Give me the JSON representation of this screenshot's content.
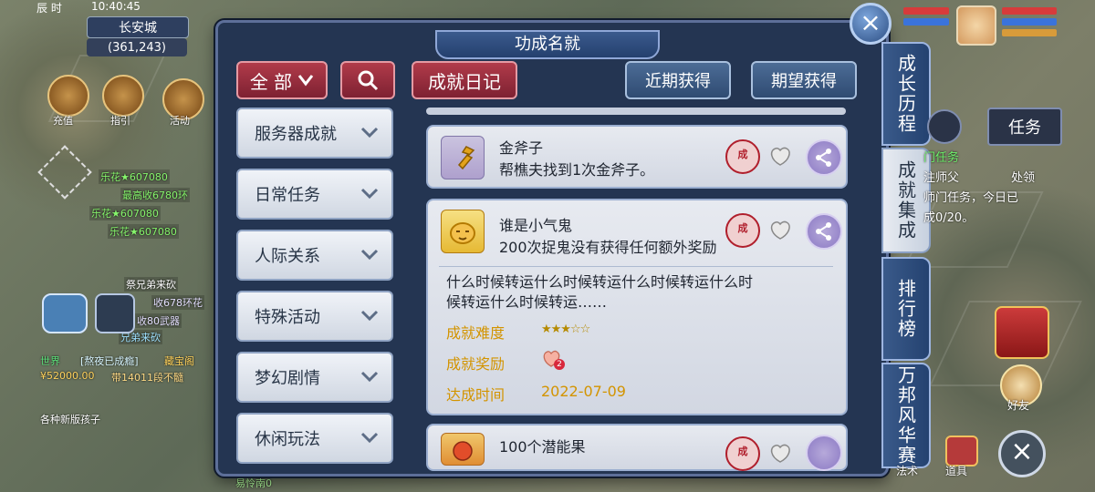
{
  "status": {
    "time_part1": "10:40",
    "time_part2": "45",
    "label_clock": "辰 时"
  },
  "location": {
    "city": "长安城",
    "coords": "(361,243)"
  },
  "left_hud": {
    "icons": [
      {
        "label": "充值"
      },
      {
        "label": "指引"
      },
      {
        "label": "活动"
      }
    ]
  },
  "chat": {
    "lines": [
      "乐花★607080",
      "最高收6780环",
      "乐花★607080",
      "乐花★607080",
      "祭兄弟来砍",
      "收678环花",
      "收80武器",
      "兄弟来砍",
      "[熬夜已成瘾]",
      "藏宝阁",
      "¥52000.00",
      "带14011段不髓",
      "各种新版孩子"
    ],
    "world_tag": "世界"
  },
  "panel": {
    "title": "功成名就",
    "filters": {
      "all_label": "全 部",
      "diary_label": "成就日记",
      "recent_label": "近期获得",
      "expected_label": "期望获得"
    },
    "categories": [
      {
        "label": "服务器成就"
      },
      {
        "label": "日常任务"
      },
      {
        "label": "人际关系"
      },
      {
        "label": "特殊活动"
      },
      {
        "label": "梦幻剧情"
      },
      {
        "label": "休闲玩法"
      }
    ],
    "achievements": [
      {
        "title": "金斧子",
        "desc": "帮樵夫找到1次金斧子。",
        "seal": "成"
      },
      {
        "title": "谁是小气鬼",
        "desc": "200次捉鬼没有获得任何额外奖励",
        "seal": "成",
        "detail": {
          "text_line1": "什么时候转运什么时候转运什么时候转运什么时",
          "text_line2": "候转运什么时候转运……",
          "difficulty_label": "成就难度",
          "stars_text": "★★★☆☆",
          "reward_label": "成就奖励",
          "reward_count": "2",
          "time_label": "达成时间",
          "date": "2022-07-09"
        }
      },
      {
        "title": "100个潜能果",
        "seal": "成"
      }
    ]
  },
  "side_tabs": [
    "成长历程",
    "成就集成",
    "排行榜",
    "万邦风华赛"
  ],
  "right_hud": {
    "task_label": "任务",
    "mission_text1": "门任务",
    "mission_text2": "注师父",
    "mission_text3": "处领",
    "mission_text4": "师门任务，今日已",
    "mission_text5": "成0/20。",
    "friend_label": "好友",
    "bag_label": "道具",
    "other_label": "法术"
  },
  "bottom_left": {
    "text": "易怜南0"
  }
}
